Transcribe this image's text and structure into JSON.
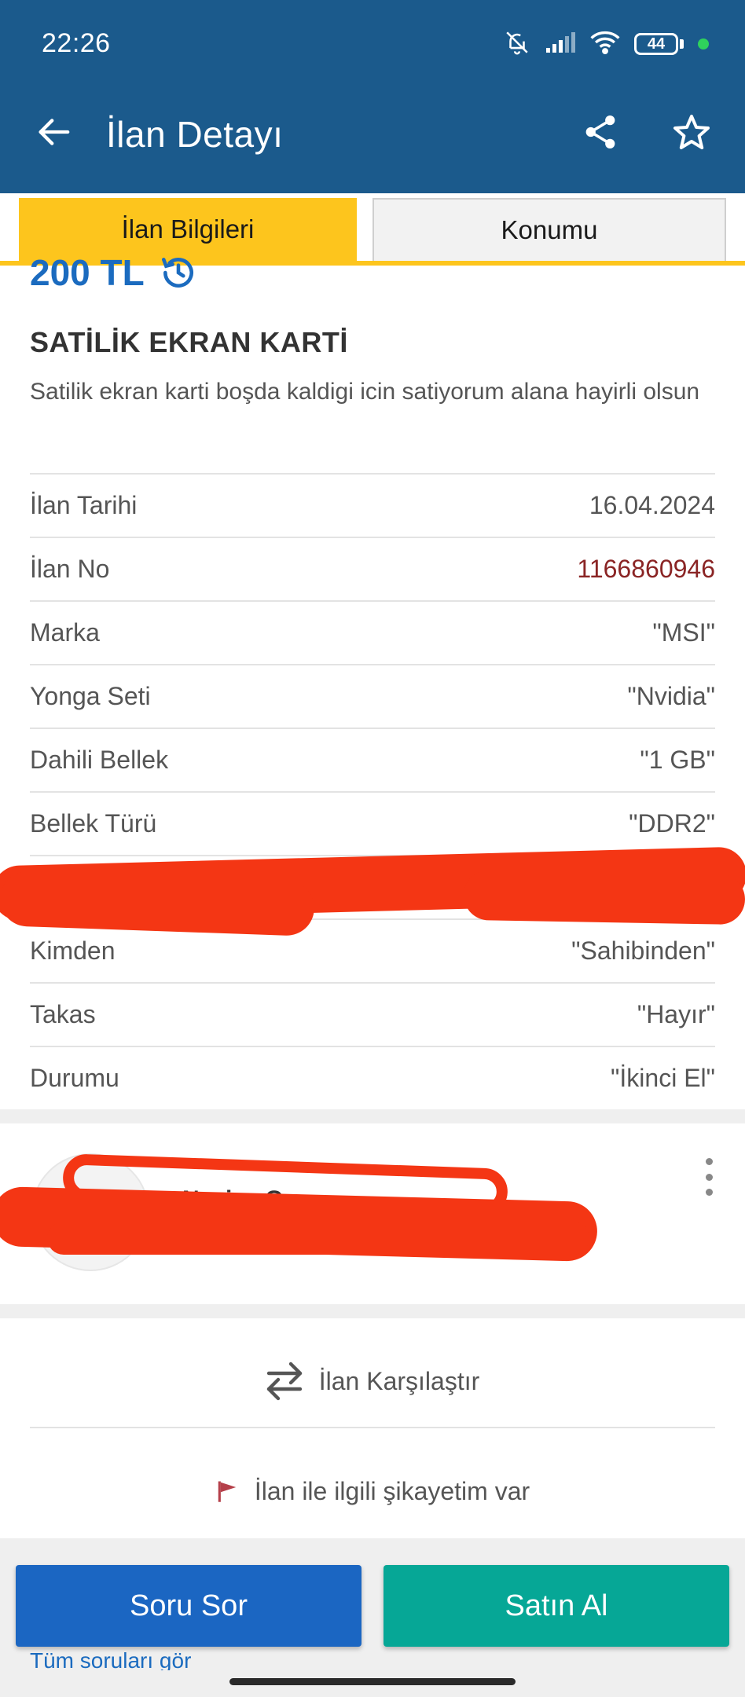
{
  "status_bar": {
    "time": "22:26",
    "battery": "44",
    "icons": [
      "bell-off-icon",
      "signal-icon",
      "wifi-icon",
      "battery-icon",
      "dot-indicator"
    ]
  },
  "app_bar": {
    "title": "İlan Detayı",
    "back_icon": "arrow-left-icon",
    "share_icon": "share-icon",
    "favorite_icon": "star-outline-icon"
  },
  "tabs": [
    {
      "label": "İlan Bilgileri",
      "active": true
    },
    {
      "label": "Konumu",
      "active": false
    }
  ],
  "listing": {
    "price": "200 TL",
    "title": "SATİLİK EKRAN KARTİ",
    "description": "Satilik ekran karti boşda kaldigi icin satiyorum alana hayirli olsun"
  },
  "details": [
    {
      "label": "İlan Tarihi",
      "value": "16.04.2024"
    },
    {
      "label": "İlan No",
      "value": "1166860946"
    },
    {
      "label": "Marka",
      "value": "\"MSI\""
    },
    {
      "label": "Yonga Seti",
      "value": "\"Nvidia\""
    },
    {
      "label": "Dahili Bellek",
      "value": "\"1 GB\""
    },
    {
      "label": "Bellek Türü",
      "value": "\"DDR2\""
    },
    {
      "label": "",
      "value": ""
    },
    {
      "label": "Kimden",
      "value": "\"Sahibinden\""
    },
    {
      "label": "Takas",
      "value": "\"Hayır\""
    },
    {
      "label": "Durumu",
      "value": "\"İkinci El\""
    }
  ],
  "seller": {
    "name": "Nasiye G."
  },
  "actions": {
    "compare": "İlan Karşılaştır",
    "report": "İlan ile ilgili şikayetim var"
  },
  "buttons": {
    "ask": "Soru Sor",
    "buy": "Satın Al"
  },
  "questions_link": "Tüm soruları gör",
  "colors": {
    "header": "#1b5a8c",
    "tab_active": "#fdc51d",
    "price": "#1b6bbf",
    "ask_button": "#1b66c2",
    "buy_button": "#06a796",
    "listing_no": "#8a2424",
    "redaction": "#f43614"
  }
}
